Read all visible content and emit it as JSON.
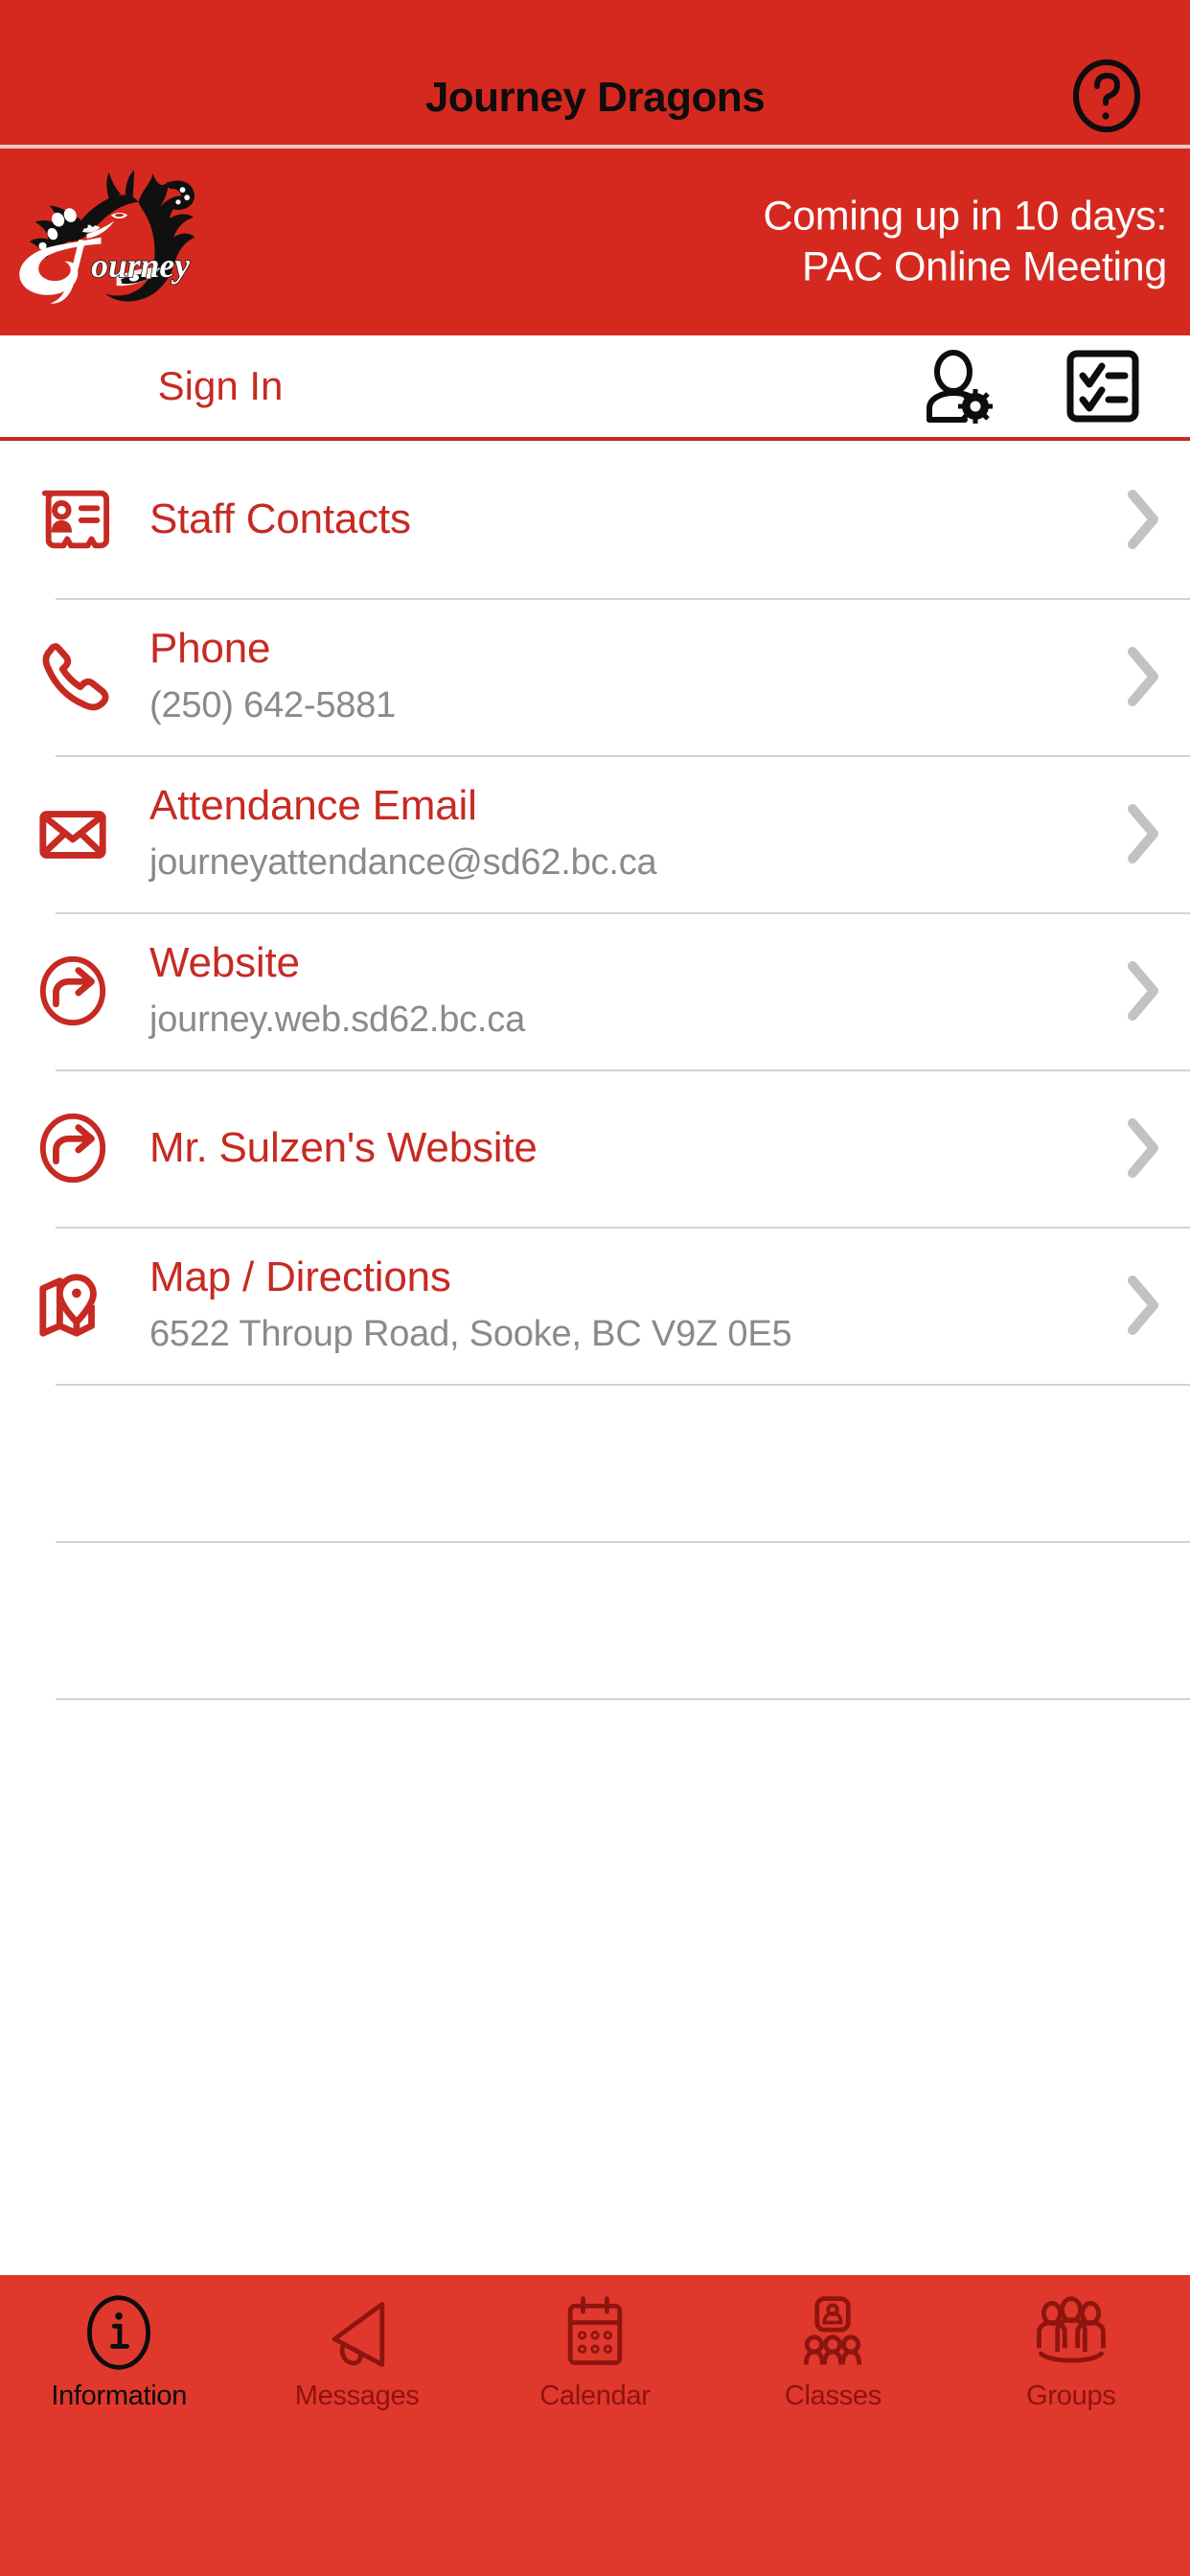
{
  "navbar": {
    "title": "Journey Dragons",
    "help_icon": "help-circle-icon"
  },
  "banner": {
    "logo_alt": "Journey Dragons logo",
    "line1": "Coming up in 10 days:",
    "line2": "PAC Online Meeting"
  },
  "signin": {
    "label": "Sign In",
    "account_settings_icon": "user-settings-icon",
    "checklist_icon": "checklist-icon"
  },
  "list": {
    "items": [
      {
        "icon": "contact-card-icon",
        "title": "Staff Contacts",
        "subtitle": ""
      },
      {
        "icon": "phone-icon",
        "title": "Phone",
        "subtitle": "(250) 642-5881"
      },
      {
        "icon": "envelope-icon",
        "title": "Attendance Email",
        "subtitle": "journeyattendance@sd62.bc.ca"
      },
      {
        "icon": "external-link-icon",
        "title": "Website",
        "subtitle": "journey.web.sd62.bc.ca"
      },
      {
        "icon": "external-link-icon",
        "title": "Mr. Sulzen's Website",
        "subtitle": ""
      },
      {
        "icon": "map-pin-icon",
        "title": "Map / Directions",
        "subtitle": "6522 Throup Road, Sooke, BC V9Z 0E5"
      }
    ],
    "chevron_icon": "chevron-right-icon",
    "empty_row_count": 3
  },
  "tabbar": {
    "tabs": [
      {
        "label": "Information",
        "icon": "info-circle-icon",
        "active": true
      },
      {
        "label": "Messages",
        "icon": "megaphone-icon",
        "active": false
      },
      {
        "label": "Calendar",
        "icon": "calendar-icon",
        "active": false
      },
      {
        "label": "Classes",
        "icon": "classes-icon",
        "active": false
      },
      {
        "label": "Groups",
        "icon": "groups-icon",
        "active": false
      }
    ]
  },
  "colors": {
    "brand_red": "#D5291F",
    "tabbar_red": "#E0382C",
    "link_red": "#C62A22",
    "subtitle_grey": "#8a8a8a",
    "divider_grey": "#d2d2d2",
    "tab_inactive": "#8E1410",
    "tab_active": "#0d0d0d"
  }
}
